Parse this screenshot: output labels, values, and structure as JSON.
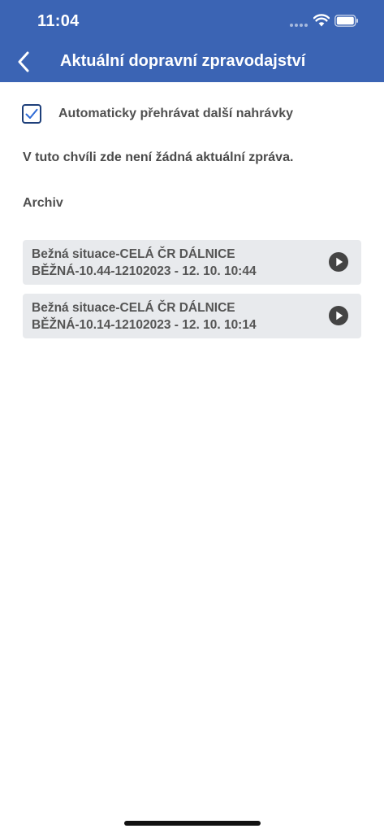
{
  "status_bar": {
    "time": "11:04"
  },
  "nav": {
    "title": "Aktuální dopravní zpravodajství"
  },
  "settings": {
    "autoplay_label": "Automaticky přehrávat další nahrávky",
    "autoplay_checked": true
  },
  "current": {
    "message": "V tuto chvíli zde není žádná aktuální zpráva."
  },
  "archive": {
    "heading": "Archiv",
    "items": [
      {
        "line1": "Bežná situace-CELÁ ČR DÁLNICE",
        "line2": "BĚŽNÁ-10.44-12102023 - 12. 10. 10:44"
      },
      {
        "line1": "Bežná situace-CELÁ ČR DÁLNICE",
        "line2": "BĚŽNÁ-10.14-12102023 - 12. 10. 10:14"
      }
    ]
  },
  "colors": {
    "header_bg": "#3b64b4",
    "checkbox_border": "#1e3f7a",
    "item_bg": "#e8eaed",
    "play_icon": "#444444"
  },
  "icons": {
    "back": "chevron-left-icon",
    "play": "play-circle-icon",
    "check": "checkmark-icon"
  }
}
